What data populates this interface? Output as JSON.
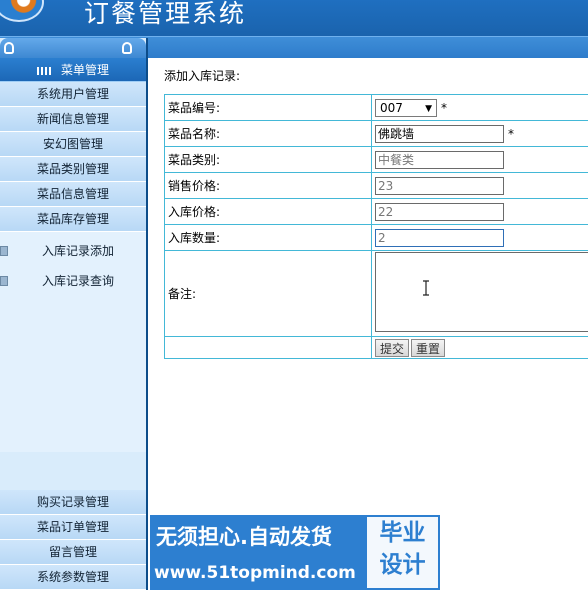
{
  "header": {
    "title": "订餐管理系统"
  },
  "sidebar": {
    "menu_title": "菜单管理",
    "items_top": [
      {
        "label": "系统用户管理"
      },
      {
        "label": "新闻信息管理"
      },
      {
        "label": "安幻图管理"
      },
      {
        "label": "菜品类别管理"
      },
      {
        "label": "菜品信息管理"
      },
      {
        "label": "菜品库存管理"
      }
    ],
    "sub_items": [
      {
        "label": "入库记录添加"
      },
      {
        "label": "入库记录查询"
      }
    ],
    "items_bottom": [
      {
        "label": "购买记录管理"
      },
      {
        "label": "菜品订单管理"
      },
      {
        "label": "留言管理"
      },
      {
        "label": "系统参数管理"
      }
    ]
  },
  "main": {
    "caption": "添加入库记录:",
    "form": {
      "dish_no_label": "菜品编号:",
      "dish_no_value": "007",
      "dish_name_label": "菜品名称:",
      "dish_name_value": "佛跳墙",
      "dish_type_label": "菜品类别:",
      "dish_type_value": "中餐类",
      "sale_price_label": "销售价格:",
      "sale_price_value": "23",
      "in_price_label": "入库价格:",
      "in_price_value": "22",
      "in_qty_label": "入库数量:",
      "in_qty_value": "2",
      "note_label": "备注:",
      "required_mark": "*",
      "submit_label": "提交",
      "reset_label": "重置"
    }
  },
  "watermark": {
    "slogan": "无须担心.自动发货",
    "url": "www.51topmind.com",
    "box_line1": "毕业",
    "box_line2": "设计"
  }
}
